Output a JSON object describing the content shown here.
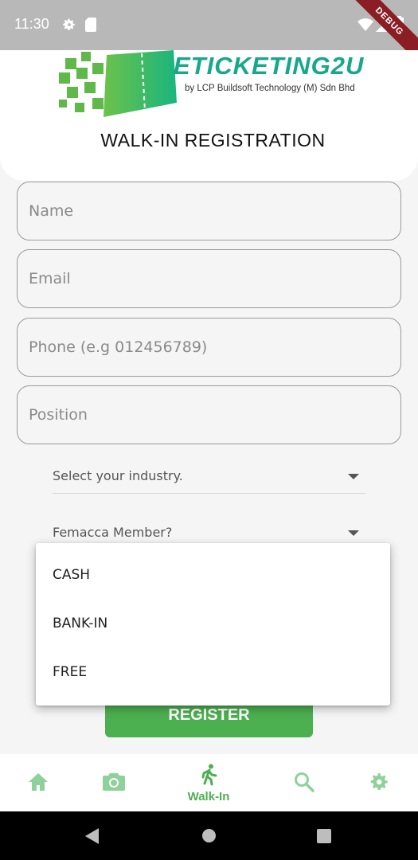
{
  "status_bar": {
    "time": "11:30",
    "debug_label": "DEBUG",
    "icons": [
      "gear-icon",
      "sd-card-icon",
      "wifi-icon",
      "signal-icon",
      "battery-icon"
    ]
  },
  "header": {
    "logo_word": "ETICKETING2U",
    "logo_sub": "by LCP Buildsoft Technology (M) Sdn Bhd",
    "title": "WALK-IN REGISTRATION"
  },
  "form": {
    "name_placeholder": "Name",
    "email_placeholder": "Email",
    "phone_placeholder": "Phone (e.g 012456789)",
    "position_placeholder": "Position",
    "industry_label": "Select your industry.",
    "member_label": "Femacca Member?",
    "register_label": "REGISTER"
  },
  "payment_menu": {
    "items": [
      "CASH",
      "BANK-IN",
      "FREE"
    ]
  },
  "bottom_nav": {
    "items": [
      {
        "icon": "home-icon",
        "label": ""
      },
      {
        "icon": "camera-icon",
        "label": ""
      },
      {
        "icon": "walk-icon",
        "label": "Walk-In",
        "active": true
      },
      {
        "icon": "search-icon",
        "label": ""
      },
      {
        "icon": "settings-icon",
        "label": ""
      }
    ]
  },
  "colors": {
    "accent": "#4caf50",
    "accent_light": "#8fd19a",
    "status_bar": "#b8b8b8",
    "debug_ribbon": "#8b1e24",
    "logo_teal": "#17a88a"
  }
}
